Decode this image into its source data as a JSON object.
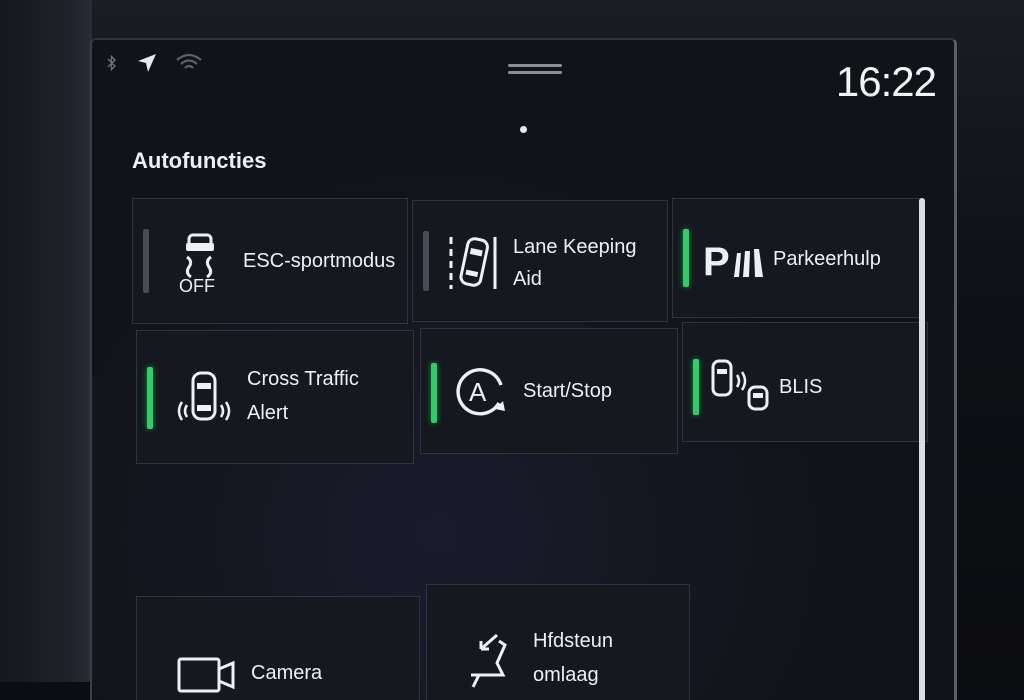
{
  "status_bar": {
    "bluetooth_icon": "bluetooth-icon",
    "location_icon": "navigation-arrow-icon",
    "wifi_icon": "wifi-icon",
    "time": "16:22"
  },
  "section_title": "Autofuncties",
  "tiles": [
    {
      "label_line1": "ESC-sportmodus",
      "label_line2": "",
      "icon": "esc-off-icon",
      "icon_text": "OFF",
      "active": false
    },
    {
      "label_line1": "Lane Keeping",
      "label_line2": "Aid",
      "icon": "lane-keeping-icon",
      "active": false
    },
    {
      "label_line1": "Parkeerhulp",
      "label_line2": "",
      "icon": "park-assist-icon",
      "icon_text": "P",
      "active": true
    },
    {
      "label_line1": "Cross Traffic",
      "label_line2": "Alert",
      "icon": "cross-traffic-icon",
      "active": true
    },
    {
      "label_line1": "Start/Stop",
      "label_line2": "",
      "icon": "start-stop-icon",
      "icon_text": "A",
      "active": true
    },
    {
      "label_line1": "BLIS",
      "label_line2": "",
      "icon": "blis-icon",
      "active": true
    },
    {
      "label_line1": "Camera",
      "label_line2": "",
      "icon": "camera-icon"
    },
    {
      "label_line1": "Hfdsteun",
      "label_line2": "omlaag",
      "icon": "headrest-fold-icon"
    }
  ],
  "colors": {
    "active_indicator": "#2ed066",
    "inactive_indicator": "#474b53"
  }
}
